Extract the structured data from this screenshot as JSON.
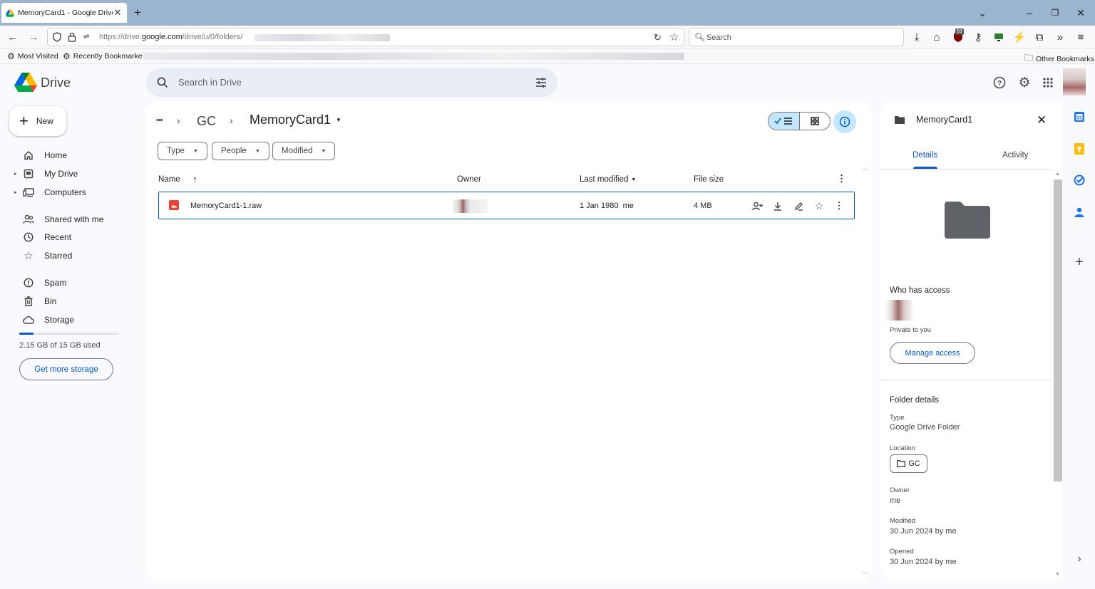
{
  "browser": {
    "tab_title": "MemoryCard1 - Google Drive",
    "url_prefix": "https://drive.",
    "url_domain": "google.com",
    "url_path": "/drive/u/0/folders/",
    "search_placeholder": "Search",
    "extension_badge": "63",
    "bookmarks": {
      "most_visited": "Most Visited",
      "recently_bookmarked": "Recently Bookmarked",
      "other": "Other Bookmarks"
    }
  },
  "drive": {
    "app_name": "Drive",
    "search_placeholder": "Search in Drive",
    "new_label": "New",
    "nav": [
      {
        "label": "Home"
      },
      {
        "label": "My Drive"
      },
      {
        "label": "Computers"
      },
      {
        "label": "Shared with me"
      },
      {
        "label": "Recent"
      },
      {
        "label": "Starred"
      },
      {
        "label": "Spam"
      },
      {
        "label": "Bin"
      },
      {
        "label": "Storage"
      }
    ],
    "storage_text": "2.15 GB of 15 GB used",
    "storage_fraction": 0.143,
    "storage_button": "Get more storage"
  },
  "main": {
    "breadcrumb": {
      "ellipsis": "•••",
      "parent": "GC",
      "current": "MemoryCard1"
    },
    "filters": [
      "Type",
      "People",
      "Modified"
    ],
    "columns": {
      "name": "Name",
      "owner": "Owner",
      "last_modified": "Last modified",
      "file_size": "File size"
    },
    "rows": [
      {
        "name": "MemoryCard1-1.raw",
        "modified_date": "1 Jan 1980",
        "modified_by": "me",
        "size": "4 MB"
      }
    ]
  },
  "details": {
    "title": "MemoryCard1",
    "tabs": [
      "Details",
      "Activity"
    ],
    "who_has_access": "Who has access",
    "private_text": "Private to you",
    "manage_access": "Manage access",
    "folder_details": "Folder details",
    "type_label": "Type",
    "type_value": "Google Drive Folder",
    "location_label": "Location",
    "location_value": "GC",
    "owner_label": "Owner",
    "owner_value": "me",
    "modified_label": "Modified",
    "modified_value": "30 Jun 2024 by me",
    "opened_label": "Opened",
    "opened_value": "30 Jun 2024 by me"
  },
  "colors": {
    "accent": "#0b57d0",
    "selected_bg": "#c2e7ff",
    "browser_tabbar": "#9cb5cf",
    "file_icon": "#e94235"
  }
}
